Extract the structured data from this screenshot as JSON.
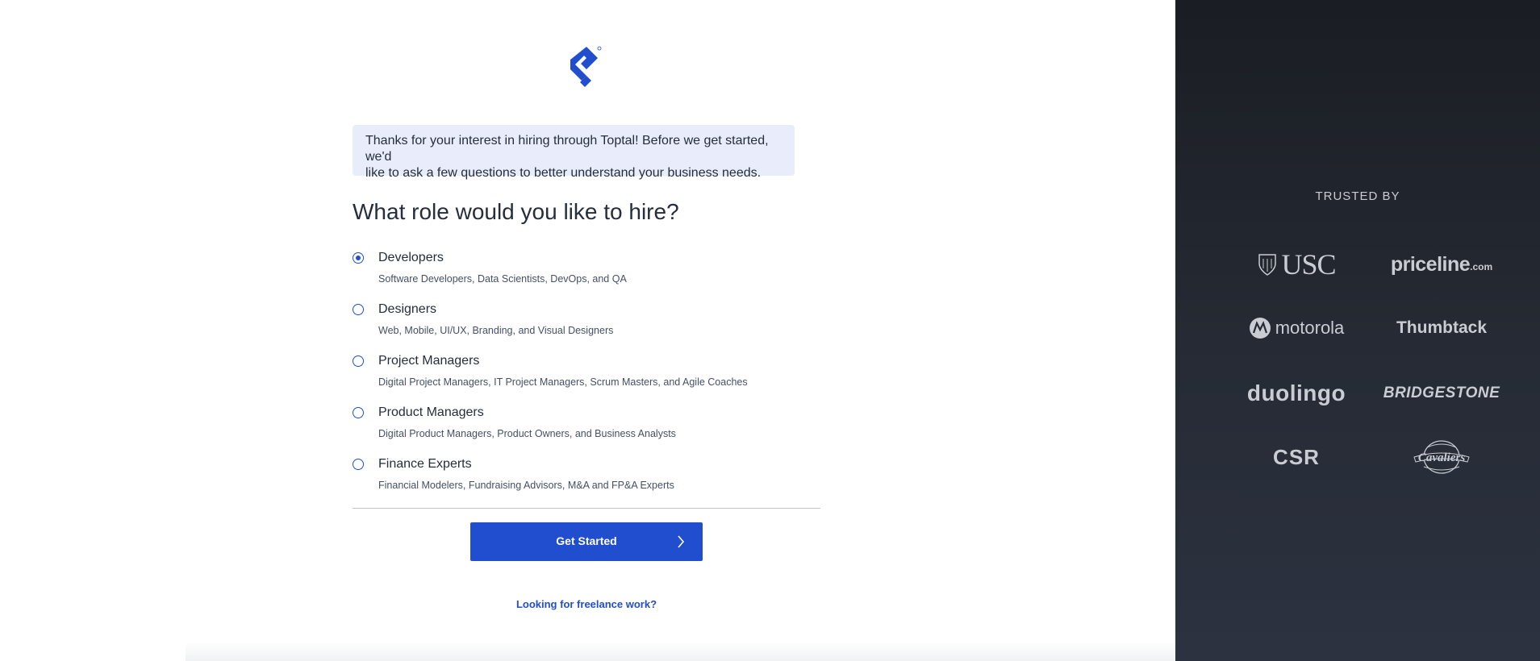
{
  "intro": {
    "line1": "Thanks for your interest in hiring through Toptal! Before we get started, we'd",
    "line2": "like to ask a few questions to better understand your business needs."
  },
  "question": "What role would you like to hire?",
  "options": [
    {
      "title": "Developers",
      "description": "Software Developers, Data Scientists, DevOps, and QA",
      "selected": true
    },
    {
      "title": "Designers",
      "description": "Web, Mobile, UI/UX, Branding, and Visual Designers",
      "selected": false
    },
    {
      "title": "Project Managers",
      "description": "Digital Project Managers, IT Project Managers, Scrum Masters, and Agile Coaches",
      "selected": false
    },
    {
      "title": "Product Managers",
      "description": "Digital Product Managers, Product Owners, and Business Analysts",
      "selected": false
    },
    {
      "title": "Finance Experts",
      "description": "Financial Modelers, Fundraising Advisors, M&A and FP&A Experts",
      "selected": false
    }
  ],
  "cta": {
    "label": "Get Started",
    "icon": "chevron-right-icon"
  },
  "freelance_link": "Looking for freelance work?",
  "trusted": {
    "heading": "TRUSTED BY",
    "logos": {
      "usc": "USC",
      "priceline": "priceline",
      "priceline_suffix": ".com",
      "motorola": "motorola",
      "thumbtack": "Thumbtack",
      "duolingo": "duolingo",
      "bridgestone": "BRIDGESTONE",
      "csr": "CSR",
      "cavaliers": "Cavaliers"
    }
  },
  "colors": {
    "brand": "#204ecf",
    "intro_bg": "#e9edfb",
    "panel_dark": "#262b35",
    "logo_gray": "#c9ccd2"
  }
}
